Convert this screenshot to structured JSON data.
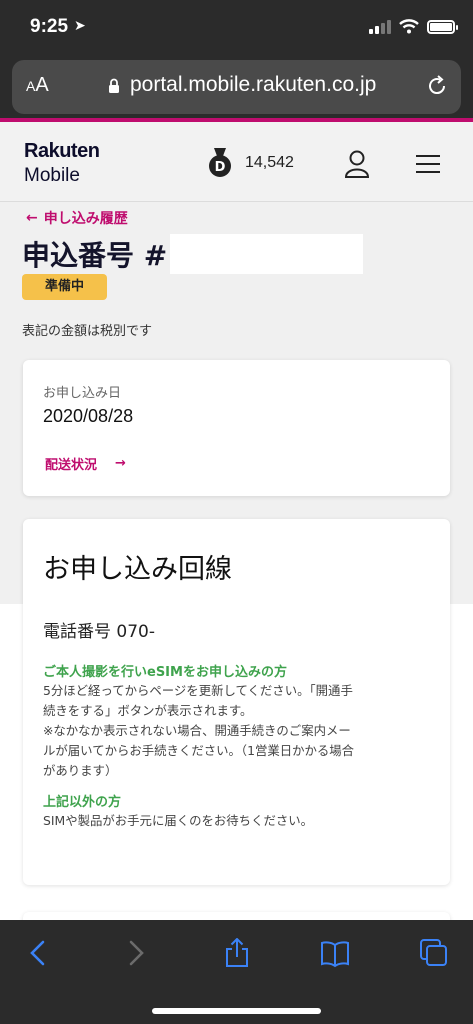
{
  "status_bar": {
    "time": "9:25"
  },
  "browser": {
    "aa_label_small": "A",
    "aa_label_large": "A",
    "url": "portal.mobile.rakuten.co.jp"
  },
  "header": {
    "logo_line1": "Rakuten",
    "logo_line2": "Mobile",
    "points": "14,542",
    "points_badge_letter": "D"
  },
  "content": {
    "back_link": "申し込み履歴",
    "title": "申込番号 #",
    "status_badge": "準備中",
    "tax_note": "表記の金額は税別です",
    "date_card": {
      "label": "お申し込み日",
      "value": "2020/08/28",
      "shipping_link": "配送状況"
    },
    "line_card": {
      "heading": "お申し込み回線",
      "phone_label": "電話番号 070-",
      "esim_heading": "ご本人撮影を行いeSIMをお申し込みの方",
      "esim_line1": "5分ほど経ってからページを更新してください。「開通手",
      "esim_line2": "続きをする」ボタンが表示されます。",
      "esim_line3": "※なかなか表示されない場合、開通手続きのご案内メー",
      "esim_line4": "ルが届いてからお手続きください。（1営業日かかる場合",
      "esim_line5": "があります）",
      "other_heading": "上記以外の方",
      "other_text": "SIMや製品がお手元に届くのをお待ちください。"
    }
  },
  "colors": {
    "accent": "#bf0d6e",
    "badge": "#f5c14a",
    "green": "#3fa34d",
    "toolbar": "#2b2b2b",
    "ios_blue": "#3b82f6"
  }
}
